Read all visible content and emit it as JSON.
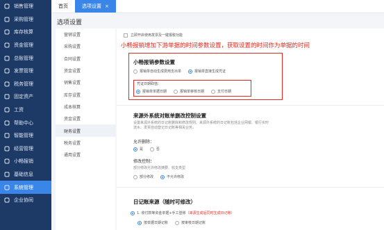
{
  "sidebar": {
    "items": [
      {
        "label": "销售管理",
        "icon": "sales-icon"
      },
      {
        "label": "采购管理",
        "icon": "purchase-icon"
      },
      {
        "label": "库存核算",
        "icon": "inventory-icon"
      },
      {
        "label": "资金管理",
        "icon": "funds-icon"
      },
      {
        "label": "总账管理",
        "icon": "ledger-icon"
      },
      {
        "label": "发票管理",
        "icon": "invoice-icon"
      },
      {
        "label": "税务管理",
        "icon": "tax-icon"
      },
      {
        "label": "固定资产",
        "icon": "asset-icon"
      },
      {
        "label": "工资",
        "icon": "salary-icon"
      },
      {
        "label": "帮助中心",
        "icon": "help-icon"
      },
      {
        "label": "智能管理",
        "icon": "smart-icon"
      },
      {
        "label": "经营管理",
        "icon": "business-icon"
      },
      {
        "label": "小畅报销",
        "icon": "expense-icon"
      },
      {
        "label": "基础信息",
        "icon": "info-icon"
      },
      {
        "label": "系统管理",
        "icon": "system-icon"
      },
      {
        "label": "企业协同",
        "icon": "collab-icon"
      }
    ]
  },
  "tabs": {
    "home": "首页",
    "current": "选项设置",
    "close": "×"
  },
  "page_title": "选项设置",
  "subnav": {
    "items": [
      "营销设置",
      "采购设置",
      "合同设置",
      "资金设置",
      "销售设置",
      "库存设置",
      "成本核算",
      "资金设置",
      "财务设置",
      "税务设置",
      "通用设置"
    ]
  },
  "content": {
    "top_check": "立即开启使用发票及一键报税功能",
    "annotation": "小畅报销增加下游单据的时间参数设置，获取设置的时间作为单据的时间",
    "expense": {
      "title": "小畅报销参数设置",
      "option1": "报销单自动生成费用支出单",
      "option2": "报销单直接生成凭证",
      "voucher_date_label": "凭证日期取值：",
      "date_opt1": "报销单单据日期",
      "date_opt2": "报销单审核日期",
      "date_opt3": "支付日期"
    },
    "external": {
      "title": "来源外系统对账单删改控制设置",
      "desc": "设置来源外系统的日记账删除和修改规则。来源外系统的日记账包括企业网银、银行实时流水、发票自动登记日记账等相关业务。",
      "allow_delete_label": "允许删除：",
      "yes": "是",
      "no": "否",
      "modify_label": "修改控制：",
      "modify_desc": "部分修改允许修改摘要、收支类型",
      "modify_opt1": "部分修改",
      "modify_opt2": "不允许修改"
    },
    "journal": {
      "title": "日记账来源（随时可修改）",
      "src_prefix": "1. 收付款等资金单据+手工登账",
      "src_note": "（来源生成后同时生成日记账）",
      "date_opt1": "按单据日期记账",
      "date_opt2": "按审核日期记账"
    }
  },
  "colors": {
    "sidebar_bg": "#1d3a66",
    "accent": "#3a86e8",
    "annotation_red": "#e4281e"
  }
}
